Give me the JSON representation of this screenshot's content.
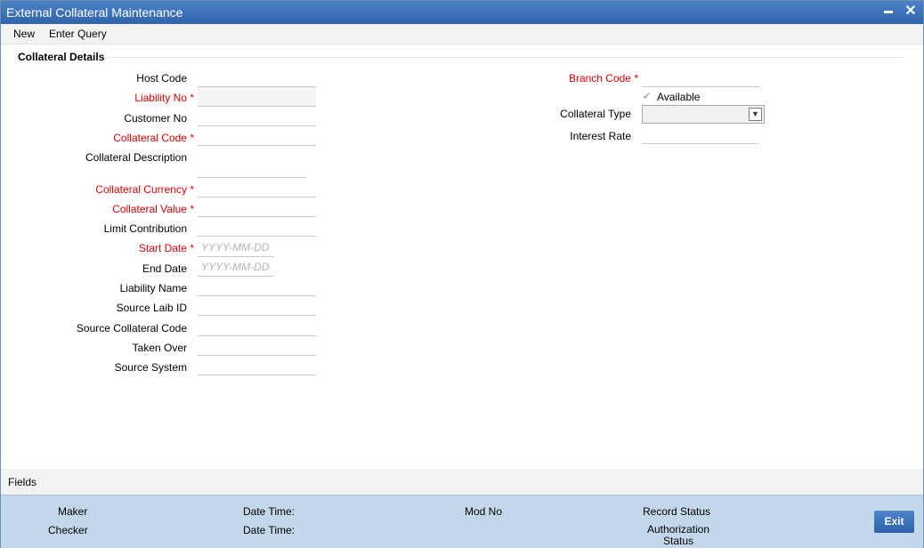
{
  "window": {
    "title": "External Collateral Maintenance"
  },
  "menu": {
    "new": "New",
    "enter_query": "Enter Query"
  },
  "section": {
    "title": "Collateral Details"
  },
  "form_left": {
    "host_code": "Host Code",
    "liability_no": "Liability No",
    "customer_no": "Customer No",
    "collateral_code": "Collateral Code",
    "collateral_description": "Collateral Description",
    "collateral_currency": "Collateral Currency",
    "collateral_value": "Collateral Value",
    "limit_contribution": "Limit Contribution",
    "start_date": "Start Date",
    "end_date": "End Date",
    "liability_name": "Liability Name",
    "source_liab_id": "Source Laib ID",
    "source_collateral_code": "Source Collateral Code",
    "taken_over": "Taken Over",
    "source_system": "Source System",
    "date_placeholder": "YYYY-MM-DD",
    "required_marker": "*"
  },
  "form_right": {
    "branch_code": "Branch Code",
    "available": "Available",
    "collateral_type": "Collateral Type",
    "interest_rate": "Interest Rate"
  },
  "fields_bar": {
    "label": "Fields"
  },
  "audit": {
    "maker": "Maker",
    "checker": "Checker",
    "date_time_1": "Date Time:",
    "date_time_2": "Date Time:",
    "mod_no": "Mod No",
    "record_status": "Record Status",
    "authorization_status": "Authorization Status",
    "exit": "Exit"
  },
  "colors": {
    "title_bar": "#3a6fb6",
    "required": "#e30000",
    "audit_bg": "#c3d7ea"
  },
  "icons": {
    "minimize": "minimize-icon",
    "close": "close-icon",
    "checkbox": "check-icon",
    "dropdown": "chevron-down-icon"
  }
}
